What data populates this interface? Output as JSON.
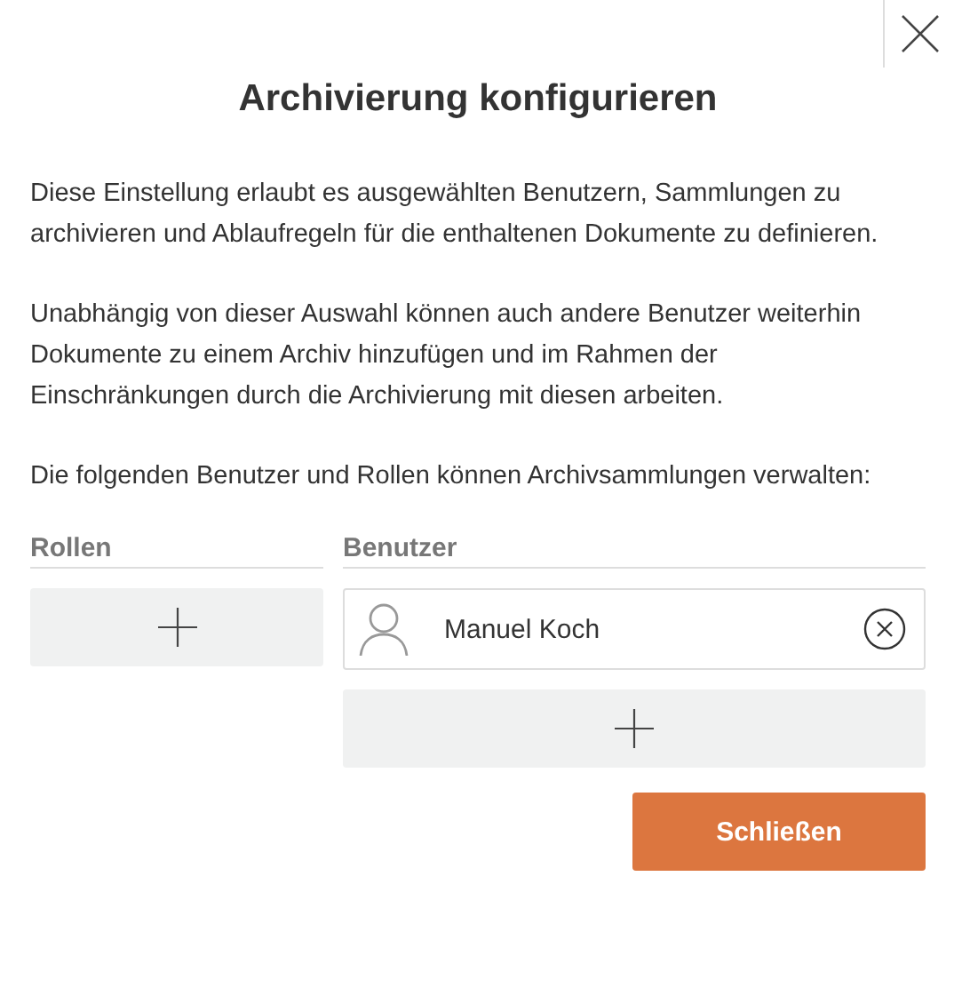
{
  "dialog": {
    "title": "Archivierung konfigurieren",
    "paragraphs": [
      "Diese Einstellung erlaubt es ausgewählten Benutzern, Sammlungen zu archivieren und Ablaufregeln für die enthaltenen Dokumente zu definieren.",
      "Unabhängig von dieser Auswahl können auch andere Benutzer weiterhin Dokumente zu einem Archiv hinzufügen und im Rahmen der Einschränkungen durch die Archivierung mit diesen arbeiten.",
      "Die folgenden Benutzer und Rollen können Archivsammlungen verwalten:"
    ],
    "roles": {
      "heading": "Rollen"
    },
    "users": {
      "heading": "Benutzer",
      "items": [
        {
          "name": "Manuel Koch"
        }
      ]
    },
    "buttons": [
      {
        "label": "Schließen",
        "kind": "primary"
      }
    ]
  }
}
